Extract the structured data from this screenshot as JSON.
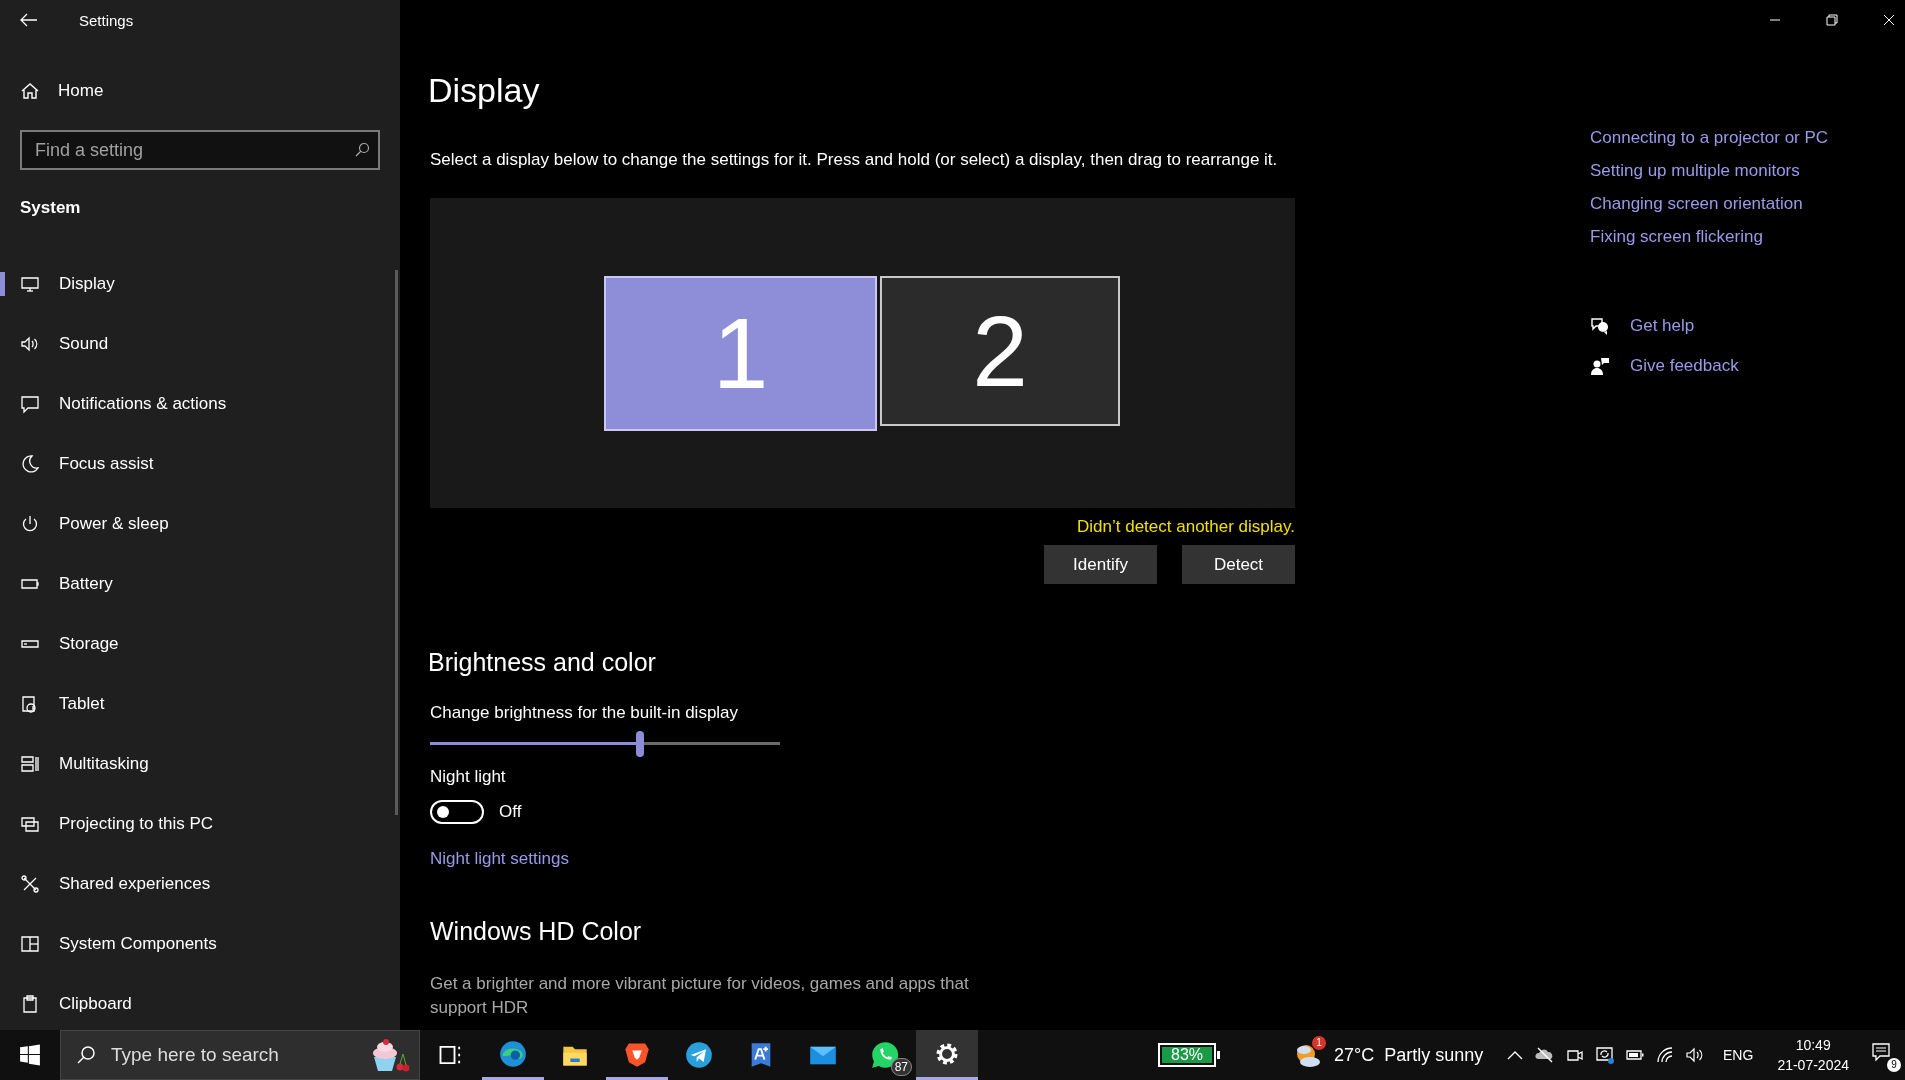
{
  "window": {
    "title": "Settings"
  },
  "sidebar": {
    "home": "Home",
    "search": {
      "placeholder": "Find a setting"
    },
    "section": "System",
    "items": [
      {
        "label": "Display",
        "kind": "display",
        "selected": true
      },
      {
        "label": "Sound",
        "kind": "sound",
        "selected": false
      },
      {
        "label": "Notifications & actions",
        "kind": "notifications",
        "selected": false
      },
      {
        "label": "Focus assist",
        "kind": "focus",
        "selected": false
      },
      {
        "label": "Power & sleep",
        "kind": "power",
        "selected": false
      },
      {
        "label": "Battery",
        "kind": "battery",
        "selected": false
      },
      {
        "label": "Storage",
        "kind": "storage",
        "selected": false
      },
      {
        "label": "Tablet",
        "kind": "tablet",
        "selected": false
      },
      {
        "label": "Multitasking",
        "kind": "multitasking",
        "selected": false
      },
      {
        "label": "Projecting to this PC",
        "kind": "projecting",
        "selected": false
      },
      {
        "label": "Shared experiences",
        "kind": "shared",
        "selected": false
      },
      {
        "label": "System Components",
        "kind": "components",
        "selected": false
      },
      {
        "label": "Clipboard",
        "kind": "clipboard",
        "selected": false
      }
    ]
  },
  "main": {
    "title": "Display",
    "description": "Select a display below to change the settings for it. Press and hold (or select) a display, then drag to rearrange it.",
    "displays": [
      {
        "label": "1",
        "selected": true
      },
      {
        "label": "2",
        "selected": false
      }
    ],
    "detect_message": "Didn’t detect another display.",
    "buttons": [
      "Identify",
      "Detect"
    ],
    "brightness": {
      "heading": "Brightness and color",
      "label": "Change brightness for the built-in display",
      "level": 0.6
    },
    "night_light": {
      "label": "Night light",
      "on": false,
      "state": "Off",
      "link": "Night light settings"
    },
    "hd_color": {
      "heading": "Windows HD Color",
      "text": "Get a brighter and more vibrant picture for videos, games and apps that support HDR"
    }
  },
  "related_links": [
    "Connecting to a projector or PC",
    "Setting up multiple monitors",
    "Changing screen orientation",
    "Fixing screen flickering"
  ],
  "help": [
    {
      "kind": "help",
      "label": "Get help"
    },
    {
      "kind": "feedback",
      "label": "Give feedback"
    }
  ],
  "taskbar": {
    "search": {
      "placeholder": "Type here to search"
    },
    "apps": [
      {
        "kind": "taskview",
        "running": false,
        "selected": false
      },
      {
        "kind": "edge",
        "running": true,
        "selected": false
      },
      {
        "kind": "explorer",
        "running": false,
        "selected": false
      },
      {
        "kind": "brave",
        "running": true,
        "selected": false
      },
      {
        "kind": "telegram",
        "running": false,
        "selected": false
      },
      {
        "kind": "translate",
        "running": false,
        "selected": false
      },
      {
        "kind": "mail",
        "running": false,
        "selected": false
      },
      {
        "kind": "whatsapp",
        "running": false,
        "selected": false,
        "badge": "87"
      },
      {
        "kind": "settings",
        "running": true,
        "selected": true
      }
    ],
    "battery_widget": "83%",
    "weather": {
      "badge": "1",
      "temperature": "27°C",
      "condition": "Partly sunny"
    },
    "language": "ENG",
    "time": "10:49",
    "date": "21-07-2024",
    "notifications": "9"
  }
}
